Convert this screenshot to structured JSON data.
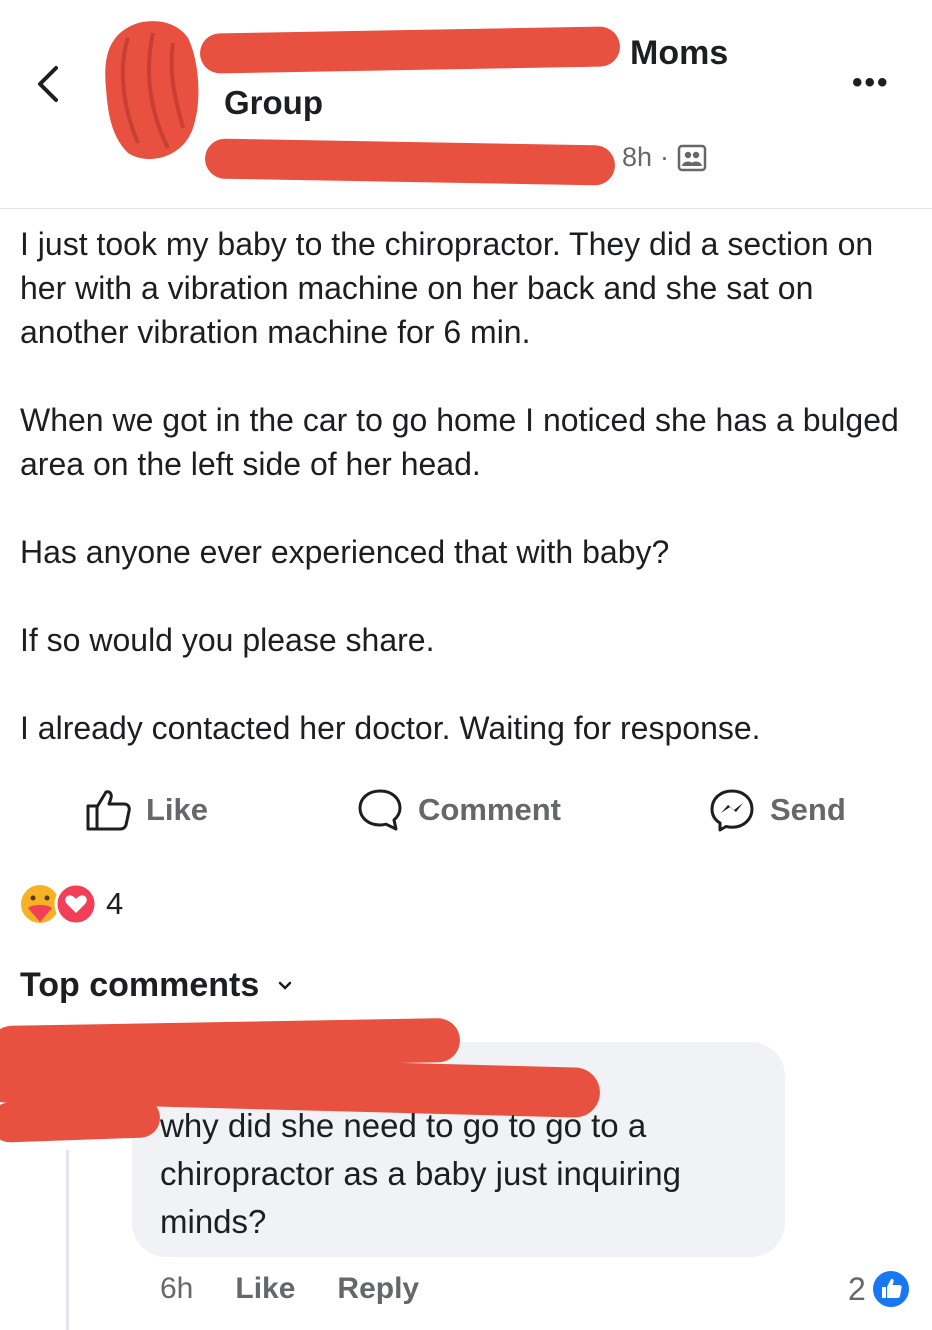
{
  "header": {
    "group_name": "Moms",
    "group_label": "Group",
    "timestamp": "8h",
    "separator": "·",
    "more_label": "•••",
    "audience_icon": "group-members-icon"
  },
  "post": {
    "paragraphs": [
      "I just took my baby to the chiropractor. They did a section on her with a vibration machine on her back and she sat on another vibration machine for 6 min.",
      "When we got in the car to go home I noticed she has a bulged area on the left side of her head.",
      "Has anyone ever experienced that with baby?",
      "If so would you please share.",
      "I already contacted her doctor. Waiting for response."
    ]
  },
  "actions": {
    "like_label": "Like",
    "comment_label": "Comment",
    "send_label": "Send"
  },
  "reactions": {
    "types": [
      "care",
      "love"
    ],
    "count": "4"
  },
  "comments": {
    "section_label": "Top comments",
    "items": [
      {
        "text": "why did she need to go to go  to a chiropractor as a baby just inquiring minds?",
        "time": "6h",
        "like_label": "Like",
        "reply_label": "Reply",
        "like_count": "2"
      }
    ]
  },
  "colors": {
    "redaction": "#e8503f",
    "muted_text": "#65676b",
    "bubble_bg": "#f0f2f5",
    "like_blue": "#1877f2",
    "love_red": "#f33e58",
    "care_yellow": "#f7b125"
  }
}
